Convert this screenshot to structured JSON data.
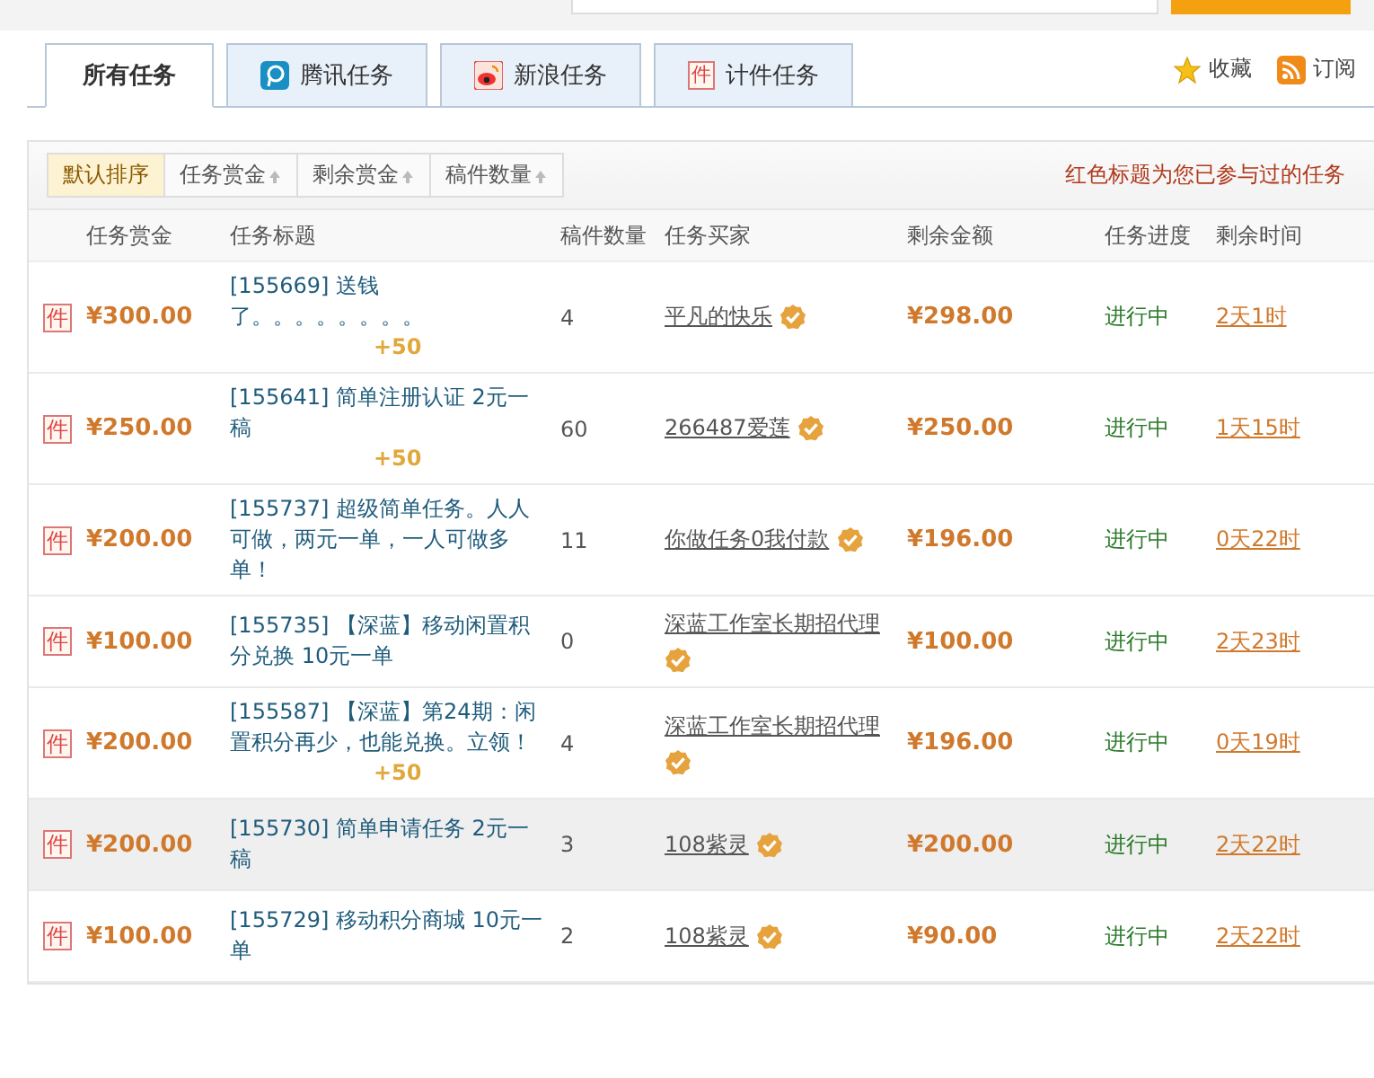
{
  "tabs": [
    {
      "label": "所有任务",
      "selected": true,
      "kind": "all"
    },
    {
      "label": "腾讯任务",
      "selected": false,
      "kind": "tencent"
    },
    {
      "label": "新浪任务",
      "selected": false,
      "kind": "sina"
    },
    {
      "label": "计件任务",
      "selected": false,
      "kind": "piece",
      "mark": "件"
    }
  ],
  "links": [
    {
      "label": "收藏",
      "kind": "star"
    },
    {
      "label": "订阅",
      "kind": "rss"
    }
  ],
  "sort_options": [
    {
      "label": "默认排序",
      "selected": true
    },
    {
      "label": "任务赏金",
      "selected": false
    },
    {
      "label": "剩余赏金",
      "selected": false
    },
    {
      "label": "稿件数量",
      "selected": false
    }
  ],
  "notice": "红色标题为您已参与过的任务",
  "table": {
    "columns": [
      "任务赏金",
      "任务标题",
      "稿件数量",
      "任务买家",
      "剩余金额",
      "任务进度",
      "剩余时间"
    ],
    "rows": [
      {
        "mark": "件",
        "reward": "¥300.00",
        "title": "[155669] 送钱了。。。。。。。。",
        "bonus": "+50",
        "count": "4",
        "buyer": "平凡的快乐",
        "remaining": "¥298.00",
        "progress": "进行中",
        "time": "2天1时",
        "highlighted": false
      },
      {
        "mark": "件",
        "reward": "¥250.00",
        "title": "[155641] 简单注册认证 2元一稿",
        "bonus": "+50",
        "count": "60",
        "buyer": "266487爱莲",
        "remaining": "¥250.00",
        "progress": "进行中",
        "time": "1天15时",
        "highlighted": false
      },
      {
        "mark": "件",
        "reward": "¥200.00",
        "title": "[155737] 超级简单任务。人人可做，两元一单，一人可做多单！",
        "count": "11",
        "buyer": "你做任务0我付款",
        "remaining": "¥196.00",
        "progress": "进行中",
        "time": "0天22时",
        "highlighted": false
      },
      {
        "mark": "件",
        "reward": "¥100.00",
        "title": "[155735] 【深蓝】移动闲置积分兑换 10元一单",
        "count": "0",
        "buyer": "深蓝工作室长期招代理",
        "remaining": "¥100.00",
        "progress": "进行中",
        "time": "2天23时",
        "highlighted": false
      },
      {
        "mark": "件",
        "reward": "¥200.00",
        "title": "[155587] 【深蓝】第24期：闲置积分再少，也能兑换。立领！",
        "bonus": "+50",
        "count": "4",
        "buyer": "深蓝工作室长期招代理",
        "remaining": "¥196.00",
        "progress": "进行中",
        "time": "0天19时",
        "highlighted": false
      },
      {
        "mark": "件",
        "reward": "¥200.00",
        "title": "[155730] 简单申请任务 2元一稿",
        "count": "3",
        "buyer": "108紫灵",
        "remaining": "¥200.00",
        "progress": "进行中",
        "time": "2天22时",
        "highlighted": true
      },
      {
        "mark": "件",
        "reward": "¥100.00",
        "title": "[155729] 移动积分商城 10元一单",
        "count": "2",
        "buyer": "108紫灵",
        "remaining": "¥90.00",
        "progress": "进行中",
        "time": "2天22时",
        "highlighted": false
      }
    ]
  }
}
